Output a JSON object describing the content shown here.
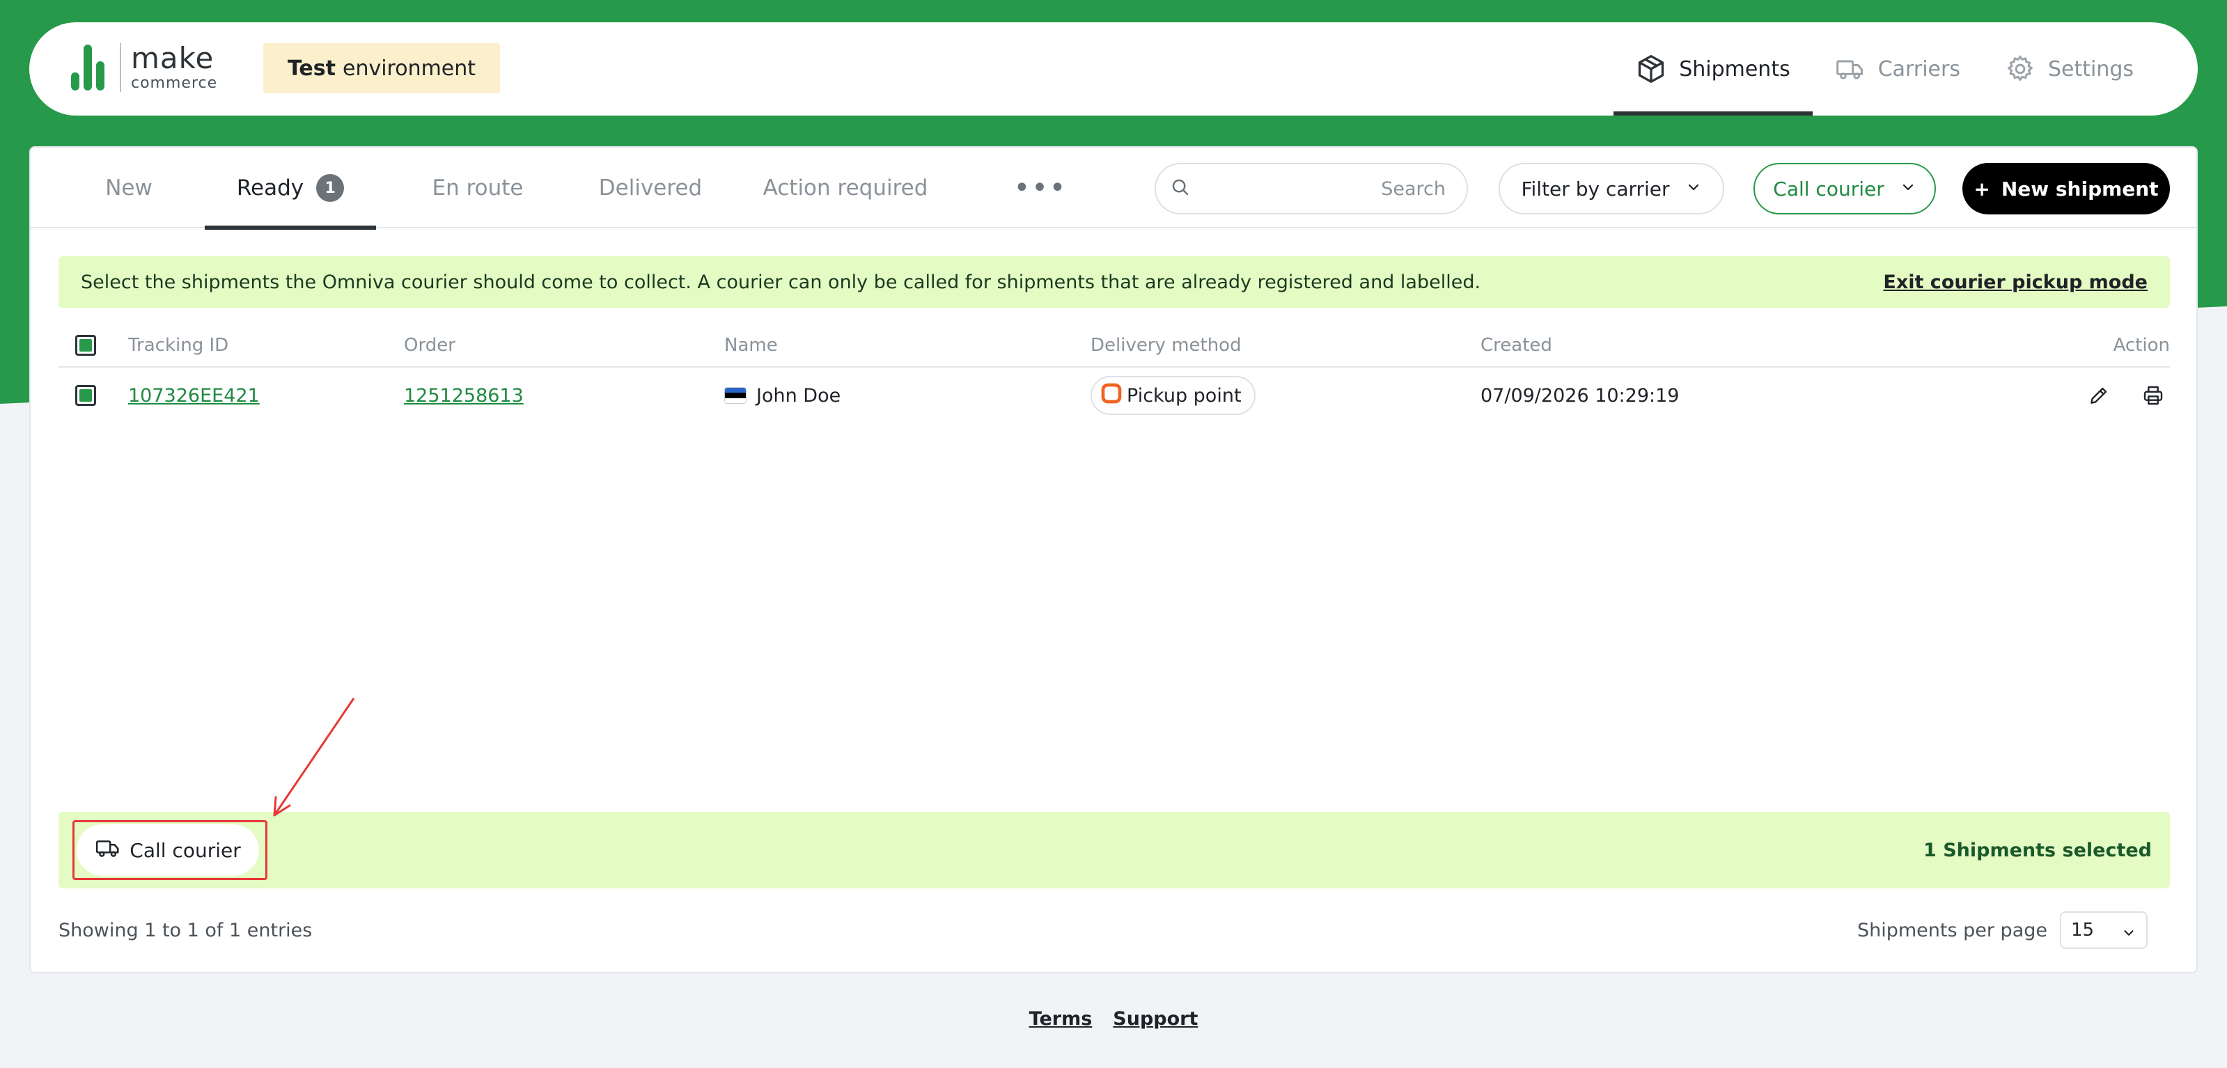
{
  "brand": {
    "logo_make": "make",
    "logo_commerce": "commerce",
    "env_badge_bold": "Test",
    "env_badge_rest": "environment",
    "brand_color": "#269a4a"
  },
  "top_nav": {
    "items": [
      {
        "label": "Shipments",
        "icon": "box-icon",
        "active": true
      },
      {
        "label": "Carriers",
        "icon": "truck-icon",
        "active": false
      },
      {
        "label": "Settings",
        "icon": "gear-icon",
        "active": false
      }
    ]
  },
  "tabs": {
    "new": "New",
    "ready": "Ready",
    "ready_count": "1",
    "en_route": "En route",
    "delivered": "Delivered",
    "action_required": "Action required",
    "more": "•••"
  },
  "toolbar": {
    "search_placeholder": "Search",
    "filter_label": "Filter by carrier",
    "call_courier_label": "Call courier",
    "new_shipment_label": "New shipment",
    "new_shipment_plus": "+"
  },
  "info_banner": {
    "message": "Select the shipments the Omniva courier should come to collect. A courier can only be called for shipments that are already registered and labelled.",
    "exit_link": "Exit courier pickup mode",
    "background": "#e4fbc4"
  },
  "table": {
    "headers": {
      "tracking_id": "Tracking ID",
      "order": "Order",
      "name": "Name",
      "delivery_method": "Delivery method",
      "created": "Created",
      "action": "Action"
    },
    "rows": [
      {
        "selected": true,
        "tracking_id": "107326EE421",
        "order": "1251258613",
        "name": "John Doe",
        "flag": "estonia-flag-icon",
        "delivery_method": "Pickup point",
        "delivery_icon": "omniva-logo-icon",
        "created": "07/09/2026 10:29:19"
      }
    ]
  },
  "bottom_bar": {
    "call_courier_label": "Call courier",
    "selected_text": "1 Shipments selected"
  },
  "pagination": {
    "showing_text": "Showing 1 to 1 of 1 entries",
    "per_page_label": "Shipments per page",
    "per_page_value": "15"
  },
  "footer": {
    "terms": "Terms",
    "support": "Support"
  }
}
